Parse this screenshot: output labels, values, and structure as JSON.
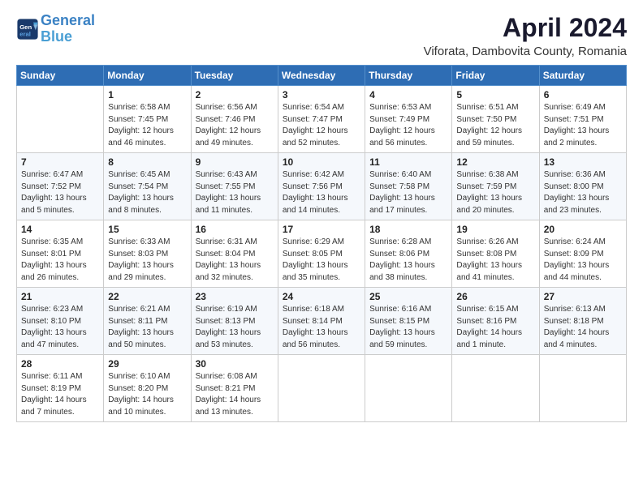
{
  "header": {
    "logo_line1": "General",
    "logo_line2": "Blue",
    "title": "April 2024",
    "subtitle": "Viforata, Dambovita County, Romania"
  },
  "weekdays": [
    "Sunday",
    "Monday",
    "Tuesday",
    "Wednesday",
    "Thursday",
    "Friday",
    "Saturday"
  ],
  "weeks": [
    [
      {
        "day": "",
        "info": ""
      },
      {
        "day": "1",
        "info": "Sunrise: 6:58 AM\nSunset: 7:45 PM\nDaylight: 12 hours\nand 46 minutes."
      },
      {
        "day": "2",
        "info": "Sunrise: 6:56 AM\nSunset: 7:46 PM\nDaylight: 12 hours\nand 49 minutes."
      },
      {
        "day": "3",
        "info": "Sunrise: 6:54 AM\nSunset: 7:47 PM\nDaylight: 12 hours\nand 52 minutes."
      },
      {
        "day": "4",
        "info": "Sunrise: 6:53 AM\nSunset: 7:49 PM\nDaylight: 12 hours\nand 56 minutes."
      },
      {
        "day": "5",
        "info": "Sunrise: 6:51 AM\nSunset: 7:50 PM\nDaylight: 12 hours\nand 59 minutes."
      },
      {
        "day": "6",
        "info": "Sunrise: 6:49 AM\nSunset: 7:51 PM\nDaylight: 13 hours\nand 2 minutes."
      }
    ],
    [
      {
        "day": "7",
        "info": "Sunrise: 6:47 AM\nSunset: 7:52 PM\nDaylight: 13 hours\nand 5 minutes."
      },
      {
        "day": "8",
        "info": "Sunrise: 6:45 AM\nSunset: 7:54 PM\nDaylight: 13 hours\nand 8 minutes."
      },
      {
        "day": "9",
        "info": "Sunrise: 6:43 AM\nSunset: 7:55 PM\nDaylight: 13 hours\nand 11 minutes."
      },
      {
        "day": "10",
        "info": "Sunrise: 6:42 AM\nSunset: 7:56 PM\nDaylight: 13 hours\nand 14 minutes."
      },
      {
        "day": "11",
        "info": "Sunrise: 6:40 AM\nSunset: 7:58 PM\nDaylight: 13 hours\nand 17 minutes."
      },
      {
        "day": "12",
        "info": "Sunrise: 6:38 AM\nSunset: 7:59 PM\nDaylight: 13 hours\nand 20 minutes."
      },
      {
        "day": "13",
        "info": "Sunrise: 6:36 AM\nSunset: 8:00 PM\nDaylight: 13 hours\nand 23 minutes."
      }
    ],
    [
      {
        "day": "14",
        "info": "Sunrise: 6:35 AM\nSunset: 8:01 PM\nDaylight: 13 hours\nand 26 minutes."
      },
      {
        "day": "15",
        "info": "Sunrise: 6:33 AM\nSunset: 8:03 PM\nDaylight: 13 hours\nand 29 minutes."
      },
      {
        "day": "16",
        "info": "Sunrise: 6:31 AM\nSunset: 8:04 PM\nDaylight: 13 hours\nand 32 minutes."
      },
      {
        "day": "17",
        "info": "Sunrise: 6:29 AM\nSunset: 8:05 PM\nDaylight: 13 hours\nand 35 minutes."
      },
      {
        "day": "18",
        "info": "Sunrise: 6:28 AM\nSunset: 8:06 PM\nDaylight: 13 hours\nand 38 minutes."
      },
      {
        "day": "19",
        "info": "Sunrise: 6:26 AM\nSunset: 8:08 PM\nDaylight: 13 hours\nand 41 minutes."
      },
      {
        "day": "20",
        "info": "Sunrise: 6:24 AM\nSunset: 8:09 PM\nDaylight: 13 hours\nand 44 minutes."
      }
    ],
    [
      {
        "day": "21",
        "info": "Sunrise: 6:23 AM\nSunset: 8:10 PM\nDaylight: 13 hours\nand 47 minutes."
      },
      {
        "day": "22",
        "info": "Sunrise: 6:21 AM\nSunset: 8:11 PM\nDaylight: 13 hours\nand 50 minutes."
      },
      {
        "day": "23",
        "info": "Sunrise: 6:19 AM\nSunset: 8:13 PM\nDaylight: 13 hours\nand 53 minutes."
      },
      {
        "day": "24",
        "info": "Sunrise: 6:18 AM\nSunset: 8:14 PM\nDaylight: 13 hours\nand 56 minutes."
      },
      {
        "day": "25",
        "info": "Sunrise: 6:16 AM\nSunset: 8:15 PM\nDaylight: 13 hours\nand 59 minutes."
      },
      {
        "day": "26",
        "info": "Sunrise: 6:15 AM\nSunset: 8:16 PM\nDaylight: 14 hours\nand 1 minute."
      },
      {
        "day": "27",
        "info": "Sunrise: 6:13 AM\nSunset: 8:18 PM\nDaylight: 14 hours\nand 4 minutes."
      }
    ],
    [
      {
        "day": "28",
        "info": "Sunrise: 6:11 AM\nSunset: 8:19 PM\nDaylight: 14 hours\nand 7 minutes."
      },
      {
        "day": "29",
        "info": "Sunrise: 6:10 AM\nSunset: 8:20 PM\nDaylight: 14 hours\nand 10 minutes."
      },
      {
        "day": "30",
        "info": "Sunrise: 6:08 AM\nSunset: 8:21 PM\nDaylight: 14 hours\nand 13 minutes."
      },
      {
        "day": "",
        "info": ""
      },
      {
        "day": "",
        "info": ""
      },
      {
        "day": "",
        "info": ""
      },
      {
        "day": "",
        "info": ""
      }
    ]
  ]
}
